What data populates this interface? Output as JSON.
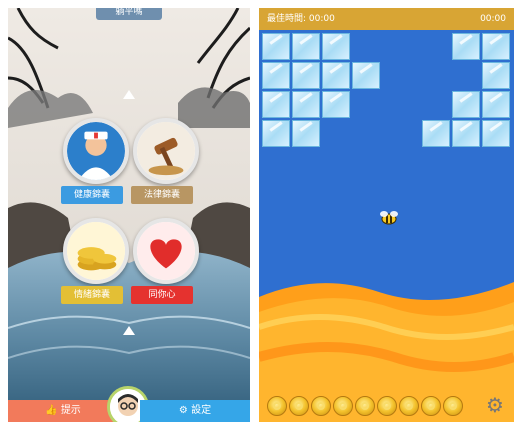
{
  "left_app": {
    "top_badge": "躺平嗎",
    "buttons": [
      {
        "label": "健康錦囊",
        "color": "#3b9be1"
      },
      {
        "label": "法律錦囊",
        "color": "#b89663"
      },
      {
        "label": "情緒錦囊",
        "color": "#e3bf35"
      },
      {
        "label": "同你心",
        "color": "#e5322f"
      }
    ],
    "bottom_left_label": "提示",
    "bottom_right_label": "設定"
  },
  "right_app": {
    "best_time": "最佳時間: 00:00",
    "timer": "00:00",
    "coin_count": 9
  }
}
